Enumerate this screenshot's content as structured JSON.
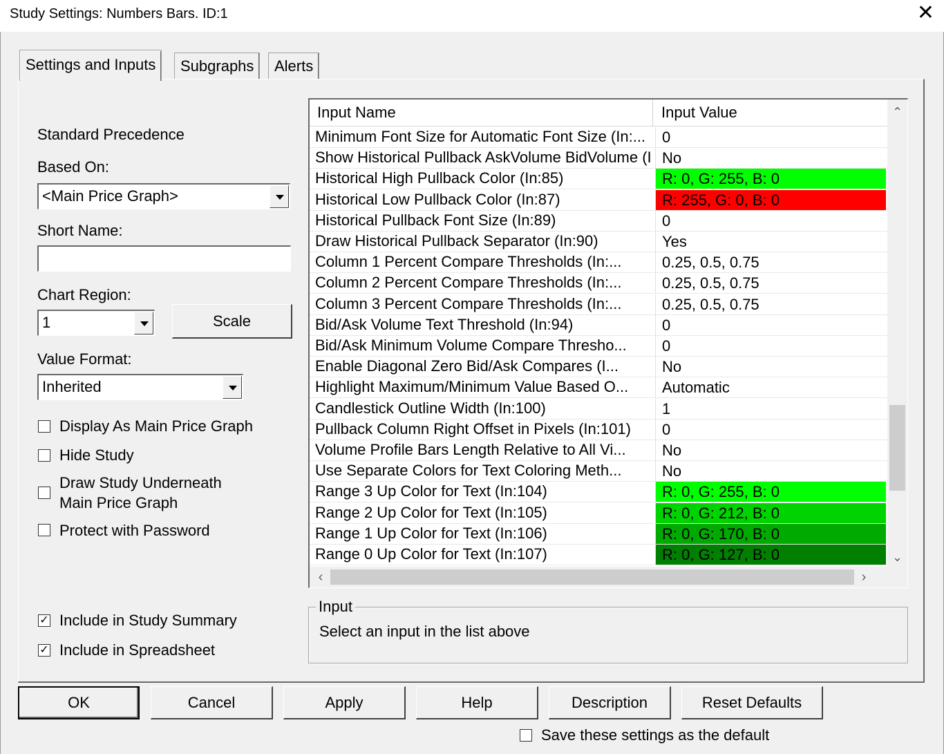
{
  "window": {
    "title": "Study Settings: Numbers Bars. ID:1",
    "close_glyph": "✕"
  },
  "tabs": [
    {
      "label": "Settings and Inputs",
      "active": true
    },
    {
      "label": "Subgraphs",
      "active": false
    },
    {
      "label": "Alerts",
      "active": false
    }
  ],
  "left": {
    "standard_precedence": "Standard Precedence",
    "based_on_label": "Based On:",
    "based_on_value": "<Main Price Graph>",
    "short_name_label": "Short Name:",
    "short_name_value": "",
    "chart_region_label": "Chart Region:",
    "chart_region_value": "1",
    "scale_button": "Scale",
    "value_format_label": "Value Format:",
    "value_format_value": "Inherited",
    "checkboxes": [
      {
        "label": "Display As Main Price Graph",
        "checked": false
      },
      {
        "label": "Hide Study",
        "checked": false
      },
      {
        "label": "Draw Study Underneath",
        "label2": "Main Price Graph",
        "checked": false
      },
      {
        "label": "Protect with Password",
        "checked": false
      }
    ],
    "include_summary": {
      "label": "Include in Study Summary",
      "checked": true
    },
    "include_spreadsheet": {
      "label": "Include in Spreadsheet",
      "checked": true
    },
    "check_glyph": "✓"
  },
  "grid": {
    "col_name": "Input Name",
    "col_value": "Input Value",
    "rows": [
      {
        "name": "Minimum Font Size for Automatic Font Size   (In:...",
        "value": "0"
      },
      {
        "name": "Show Historical Pullback AskVolume BidVolume (In...",
        "value": "No"
      },
      {
        "name": "Historical High Pullback Color   (In:85)",
        "value": "R: 0, G: 255, B: 0",
        "bg": "#00ff00"
      },
      {
        "name": "Historical Low Pullback Color   (In:87)",
        "value": "R: 255, G: 0, B: 0",
        "bg": "#ff0000"
      },
      {
        "name": "Historical Pullback Font Size   (In:89)",
        "value": "0"
      },
      {
        "name": "Draw Historical Pullback Separator   (In:90)",
        "value": "Yes"
      },
      {
        "name": "Column 1 Percent Compare Thresholds   (In:...",
        "value": "0.25, 0.5, 0.75"
      },
      {
        "name": "Column 2 Percent Compare Thresholds   (In:...",
        "value": "0.25, 0.5, 0.75"
      },
      {
        "name": "Column 3 Percent Compare Thresholds   (In:...",
        "value": "0.25, 0.5, 0.75"
      },
      {
        "name": "Bid/Ask Volume Text Threshold   (In:94)",
        "value": "0"
      },
      {
        "name": "Bid/Ask Minimum Volume Compare Thresho...",
        "value": "0"
      },
      {
        "name": "Enable Diagonal Zero Bid/Ask Compares   (I...",
        "value": "No"
      },
      {
        "name": "Highlight Maximum/Minimum Value Based O...",
        "value": "Automatic"
      },
      {
        "name": "Candlestick Outline Width   (In:100)",
        "value": "1"
      },
      {
        "name": "Pullback Column Right Offset in Pixels   (In:101)",
        "value": "0"
      },
      {
        "name": "Volume Profile Bars Length Relative to All Vi...",
        "value": "No"
      },
      {
        "name": "Use Separate Colors for Text Coloring Meth...",
        "value": "No"
      },
      {
        "name": "Range 3 Up Color for Text   (In:104)",
        "value": "R: 0, G: 255, B: 0",
        "bg": "#00ff00"
      },
      {
        "name": "Range 2 Up Color for Text   (In:105)",
        "value": "R: 0, G: 212, B: 0",
        "bg": "#00d400"
      },
      {
        "name": "Range 1 Up Color for Text   (In:106)",
        "value": "R: 0, G: 170, B: 0",
        "bg": "#00aa00"
      },
      {
        "name": "Range 0 Up Color for Text   (In:107)",
        "value": "R: 0, G: 127, B: 0",
        "bg": "#007f00"
      }
    ],
    "scroll": {
      "up": "⌃",
      "down": "⌄",
      "left": "‹",
      "right": "›"
    }
  },
  "input_group": {
    "legend": "Input",
    "message": "Select an input in the list above"
  },
  "buttons": {
    "ok": "OK",
    "cancel": "Cancel",
    "apply": "Apply",
    "help": "Help",
    "description": "Description",
    "reset": "Reset Defaults"
  },
  "save_default": {
    "label": "Save these settings as the default",
    "checked": false
  }
}
